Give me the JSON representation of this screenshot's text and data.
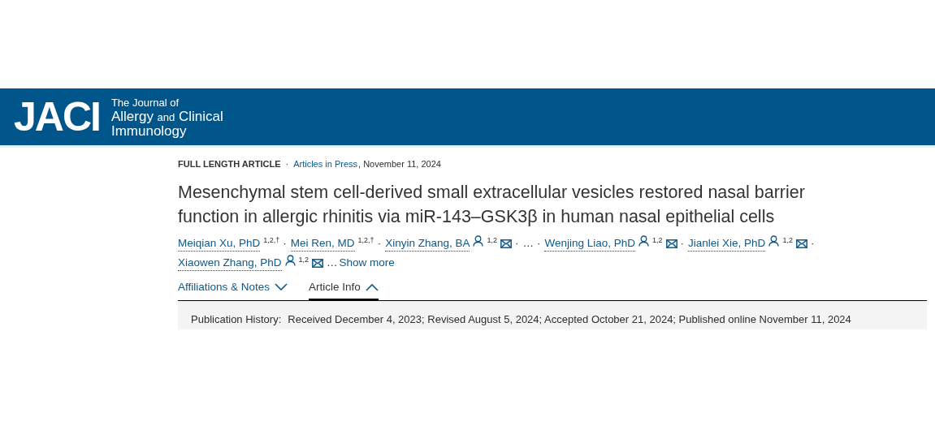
{
  "header": {
    "logo": "JACI",
    "journal_lines": [
      "The Journal of",
      "Allergy **and** Clinical",
      "Immunology"
    ]
  },
  "meta": {
    "article_type": "FULL LENGTH ARTICLE",
    "separator": "·",
    "issue_link": "Articles in Press",
    "date": ", November 11, 2024"
  },
  "title": "Mesenchymal stem cell-derived small extracellular vesicles restored nasal barrier function in allergic rhinitis via miR-143–GSK3β in human nasal epithelial cells",
  "authors": {
    "separator": "·",
    "items": [
      {
        "kind": "author",
        "name": "Meiqian Xu, PhD",
        "affiliations": "1,2,†"
      },
      {
        "kind": "author",
        "name": "Mei Ren, MD",
        "affiliations": "1,2,†"
      },
      {
        "kind": "corresponding",
        "name": "Xinyin Zhang, BA",
        "affiliations": "1,2"
      },
      {
        "kind": "ellipsis",
        "text": "…"
      },
      {
        "kind": "corresponding",
        "name": "Wenjing Liao, PhD",
        "affiliations": "1,2"
      },
      {
        "kind": "corresponding",
        "name": "Jianlei Xie, PhD",
        "affiliations": "1,2"
      },
      {
        "kind": "corresponding",
        "name": "Xiaowen Zhang, PhD",
        "affiliations": "1,2"
      }
    ],
    "more_prefix": "…",
    "show_more": "Show more"
  },
  "tabs": [
    {
      "label": "Affiliations & Notes",
      "selected": false,
      "expanded": false
    },
    {
      "label": "Article Info",
      "selected": true,
      "expanded": true
    }
  ],
  "publication_history": {
    "label": "Publication History:",
    "value": "Received December 4, 2023; Revised August 5, 2024; Accepted October 21, 2024; Published online November 11, 2024"
  }
}
